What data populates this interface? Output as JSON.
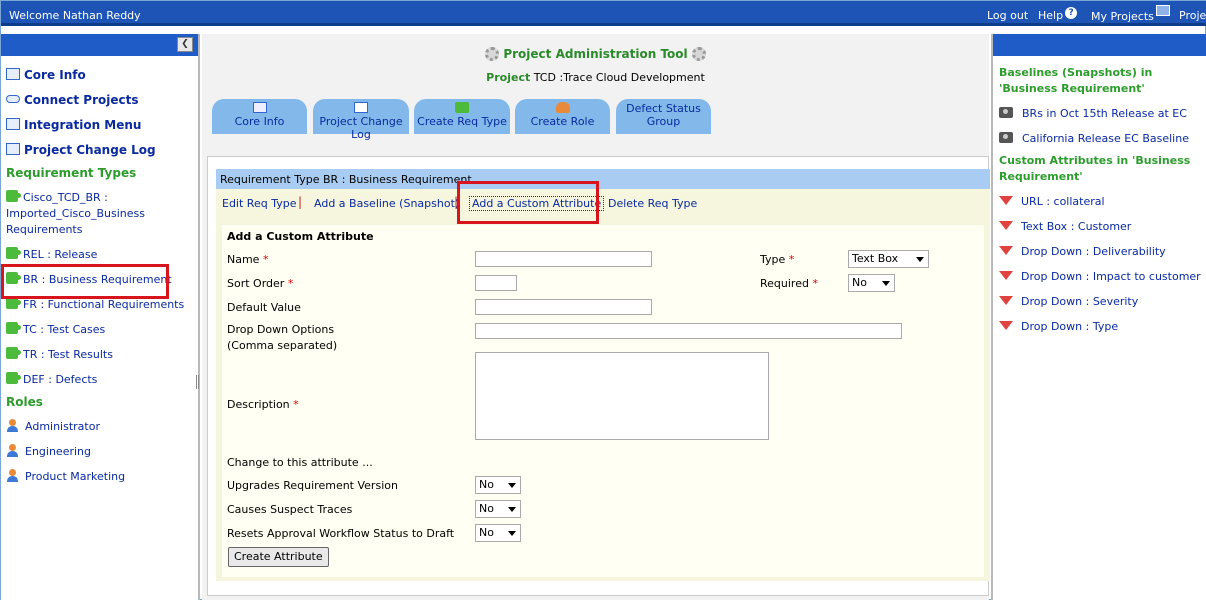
{
  "topbar": {
    "welcome": "Welcome Nathan Reddy",
    "logout": "Log out",
    "help": "Help",
    "my_projects": "My Projects",
    "projects_cut": "Projec"
  },
  "left": {
    "nav": [
      "Core Info",
      "Connect Projects",
      "Integration Menu",
      "Project Change Log"
    ],
    "req_types_title": "Requirement Types",
    "req_types": [
      "Cisco_TCD_BR : Imported_Cisco_Business Requirements",
      "REL : Release",
      "BR : Business Requirement",
      "FR : Functional Requirements",
      "TC : Test Cases",
      "TR : Test Results",
      "DEF : Defects"
    ],
    "roles_title": "Roles",
    "roles": [
      "Administrator",
      "Engineering",
      "Product Marketing"
    ]
  },
  "center": {
    "tool_title": "Project Administration Tool",
    "project_label": "Project",
    "project_value": "TCD :Trace Cloud Development",
    "tabs": [
      "Core Info",
      "Project Change Log",
      "Create Req Type",
      "Create Role",
      "Defect Status Group"
    ],
    "panel_title": "Requirement Type BR : Business Requirement",
    "sublinks": {
      "edit": "Edit Req Type",
      "baseline": "Add a Baseline (Snapshot)",
      "custom": "Add a Custom Attribute",
      "delete": "Delete Req Type"
    },
    "form": {
      "heading": "Add a Custom Attribute",
      "name_label": "Name",
      "sort_label": "Sort Order",
      "default_label": "Default Value",
      "dropdown_label": "Drop Down Options",
      "dropdown_hint": "(Comma separated)",
      "desc_label": "Description",
      "type_label": "Type",
      "type_value": "Text Box",
      "required_label": "Required",
      "required_value": "No",
      "change_label": "Change to this attribute ...",
      "upgrades_label": "Upgrades Requirement Version",
      "upgrades_value": "No",
      "suspect_label": "Causes Suspect Traces",
      "suspect_value": "No",
      "resets_label": "Resets Approval Workflow Status to Draft",
      "resets_value": "No",
      "required_star": "*",
      "submit": "Create Attribute"
    }
  },
  "right": {
    "baselines_title": "Baselines (Snapshots) in 'Business Requirement'",
    "baselines": [
      "BRs in Oct 15th Release at EC",
      "California Release EC Baseline"
    ],
    "custom_title": "Custom Attributes in 'Business Requirement'",
    "custom_attrs": [
      "URL : collateral",
      "Text Box : Customer",
      "Drop Down : Deliverability",
      "Drop Down : Impact to customer",
      "Drop Down : Severity",
      "Drop Down : Type"
    ]
  }
}
